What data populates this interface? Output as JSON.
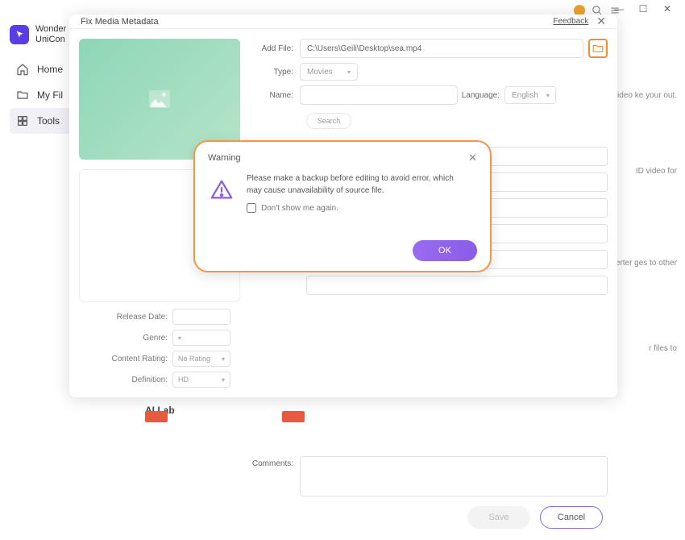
{
  "brand": {
    "line1": "Wonder",
    "line2": "UniCon"
  },
  "sidebar": {
    "items": [
      {
        "label": "Home"
      },
      {
        "label": "My Fil"
      },
      {
        "label": "Tools"
      }
    ]
  },
  "titlebar": {
    "min": "—",
    "max": "☐",
    "close": "✕"
  },
  "modal": {
    "title": "Fix Media Metadata",
    "feedback": "Feedback",
    "addFile": {
      "label": "Add File:",
      "value": "C:\\Users\\Geili\\Desktop\\sea.mp4"
    },
    "type": {
      "label": "Type:",
      "value": "Movies"
    },
    "name": {
      "label": "Name:"
    },
    "language": {
      "label": "Language:",
      "value": "English"
    },
    "search": "Search",
    "comments": {
      "label": "Comments:"
    },
    "left_meta": {
      "releaseDate": {
        "label": "Release Date:"
      },
      "genre": {
        "label": "Genre:"
      },
      "contentRating": {
        "label": "Content Rating:",
        "value": "No Rating"
      },
      "definition": {
        "label": "Definition:",
        "value": "HD"
      }
    },
    "footer": {
      "save": "Save",
      "cancel": "Cancel"
    }
  },
  "warning": {
    "title": "Warning",
    "message1": "Please make a backup before editing to avoid error, which",
    "message2": "may cause unavailability of source file.",
    "dontShow": "Don't show me again.",
    "ok": "OK"
  },
  "bg": {
    "card1": "se video\nke your\nout.",
    "card2": "ID video for",
    "card3": "nverter\nges to other",
    "card4": "r files to",
    "ai_lab": "AI Lab"
  }
}
